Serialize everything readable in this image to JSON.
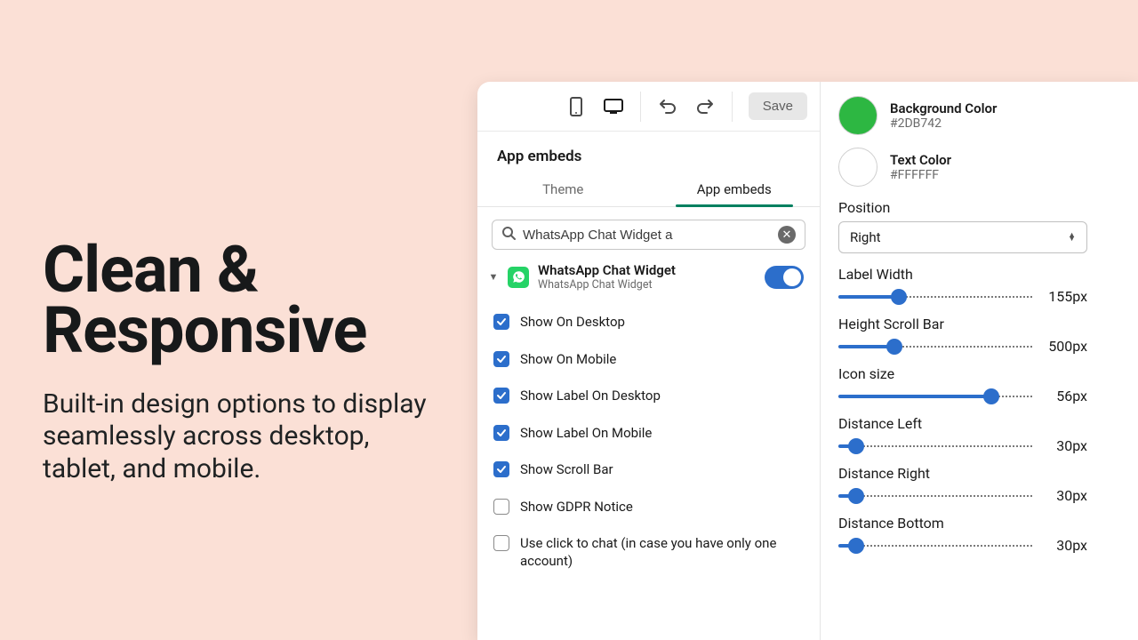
{
  "hero": {
    "title_line1": "Clean &",
    "title_line2": "Responsive",
    "subtitle": "Built-in design options to display seamlessly across desktop, tablet, and mobile."
  },
  "toolbar": {
    "save_label": "Save"
  },
  "section_title": "App embeds",
  "tabs": {
    "theme": "Theme",
    "app_embeds": "App embeds"
  },
  "search": {
    "value": "WhatsApp Chat Widget a"
  },
  "widget": {
    "title": "WhatsApp Chat Widget",
    "subtitle": "WhatsApp Chat Widget",
    "enabled": true
  },
  "checks": [
    {
      "label": "Show On Desktop",
      "checked": true
    },
    {
      "label": "Show On Mobile",
      "checked": true
    },
    {
      "label": "Show Label On Desktop",
      "checked": true
    },
    {
      "label": "Show Label On Mobile",
      "checked": true
    },
    {
      "label": "Show Scroll Bar",
      "checked": true
    },
    {
      "label": "Show GDPR Notice",
      "checked": false
    },
    {
      "label": "Use click to chat (in case you have only one account)",
      "checked": false
    }
  ],
  "right": {
    "bg_color": {
      "label": "Background Color",
      "value": "#2DB742",
      "swatch": "#2DB742"
    },
    "text_color": {
      "label": "Text Color",
      "value": "#FFFFFF",
      "swatch": "#FFFFFF"
    },
    "position_label": "Position",
    "position_value": "Right",
    "sliders": [
      {
        "label": "Label Width",
        "value": "155px",
        "fill": 31
      },
      {
        "label": "Height Scroll Bar",
        "value": "500px",
        "fill": 29
      },
      {
        "label": "Icon size",
        "value": "56px",
        "fill": 79
      },
      {
        "label": "Distance Left",
        "value": "30px",
        "fill": 9
      },
      {
        "label": "Distance Right",
        "value": "30px",
        "fill": 9
      },
      {
        "label": "Distance Bottom",
        "value": "30px",
        "fill": 9
      }
    ]
  }
}
